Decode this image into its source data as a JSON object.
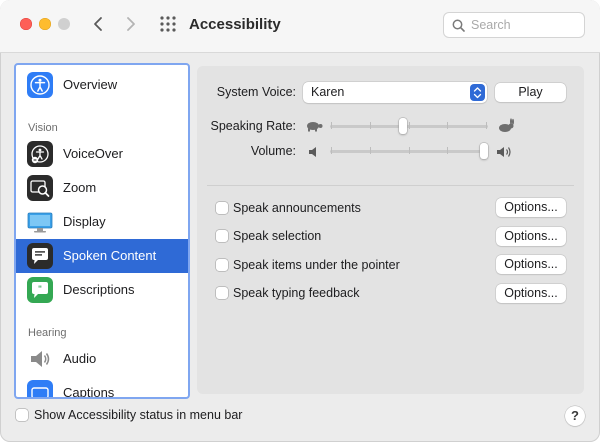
{
  "window": {
    "title": "Accessibility"
  },
  "toolbar": {
    "back_icon": "chevron-left-icon",
    "forward_icon": "chevron-right-icon",
    "grid_icon": "grid-icon",
    "search": {
      "placeholder": "Search",
      "value": ""
    }
  },
  "sidebar": {
    "items": [
      {
        "label": "Overview",
        "icon": "accessibility-icon"
      },
      {
        "label": "VoiceOver",
        "icon": "voiceover-icon"
      },
      {
        "label": "Zoom",
        "icon": "zoom-icon"
      },
      {
        "label": "Display",
        "icon": "display-icon"
      },
      {
        "label": "Spoken Content",
        "icon": "speech-bubble-icon",
        "selected": true
      },
      {
        "label": "Descriptions",
        "icon": "descriptions-icon"
      },
      {
        "label": "Audio",
        "icon": "speaker-icon"
      },
      {
        "label": "Captions",
        "icon": "captions-icon"
      }
    ],
    "sections": {
      "vision": "Vision",
      "hearing": "Hearing"
    }
  },
  "spoken_content": {
    "system_voice": {
      "label": "System Voice:",
      "value": "Karen",
      "play_label": "Play"
    },
    "speaking_rate": {
      "label": "Speaking Rate:",
      "value_fraction": 0.46,
      "slow_icon": "turtle-icon",
      "fast_icon": "rabbit-icon"
    },
    "volume": {
      "label": "Volume:",
      "value_fraction": 1.0,
      "low_icon": "volume-low-icon",
      "high_icon": "volume-high-icon"
    },
    "options": [
      {
        "label": "Speak announcements",
        "checked": false,
        "button": "Options..."
      },
      {
        "label": "Speak selection",
        "checked": false,
        "button": "Options..."
      },
      {
        "label": "Speak items under the pointer",
        "checked": false,
        "button": "Options..."
      },
      {
        "label": "Speak typing feedback",
        "checked": false,
        "button": "Options..."
      }
    ]
  },
  "footer": {
    "status_checkbox_label": "Show Accessibility status in menu bar",
    "status_checked": false,
    "help_label": "?"
  },
  "colors": {
    "accent": "#2f6ad6",
    "sidebar_focus": "#7fa6f0"
  }
}
